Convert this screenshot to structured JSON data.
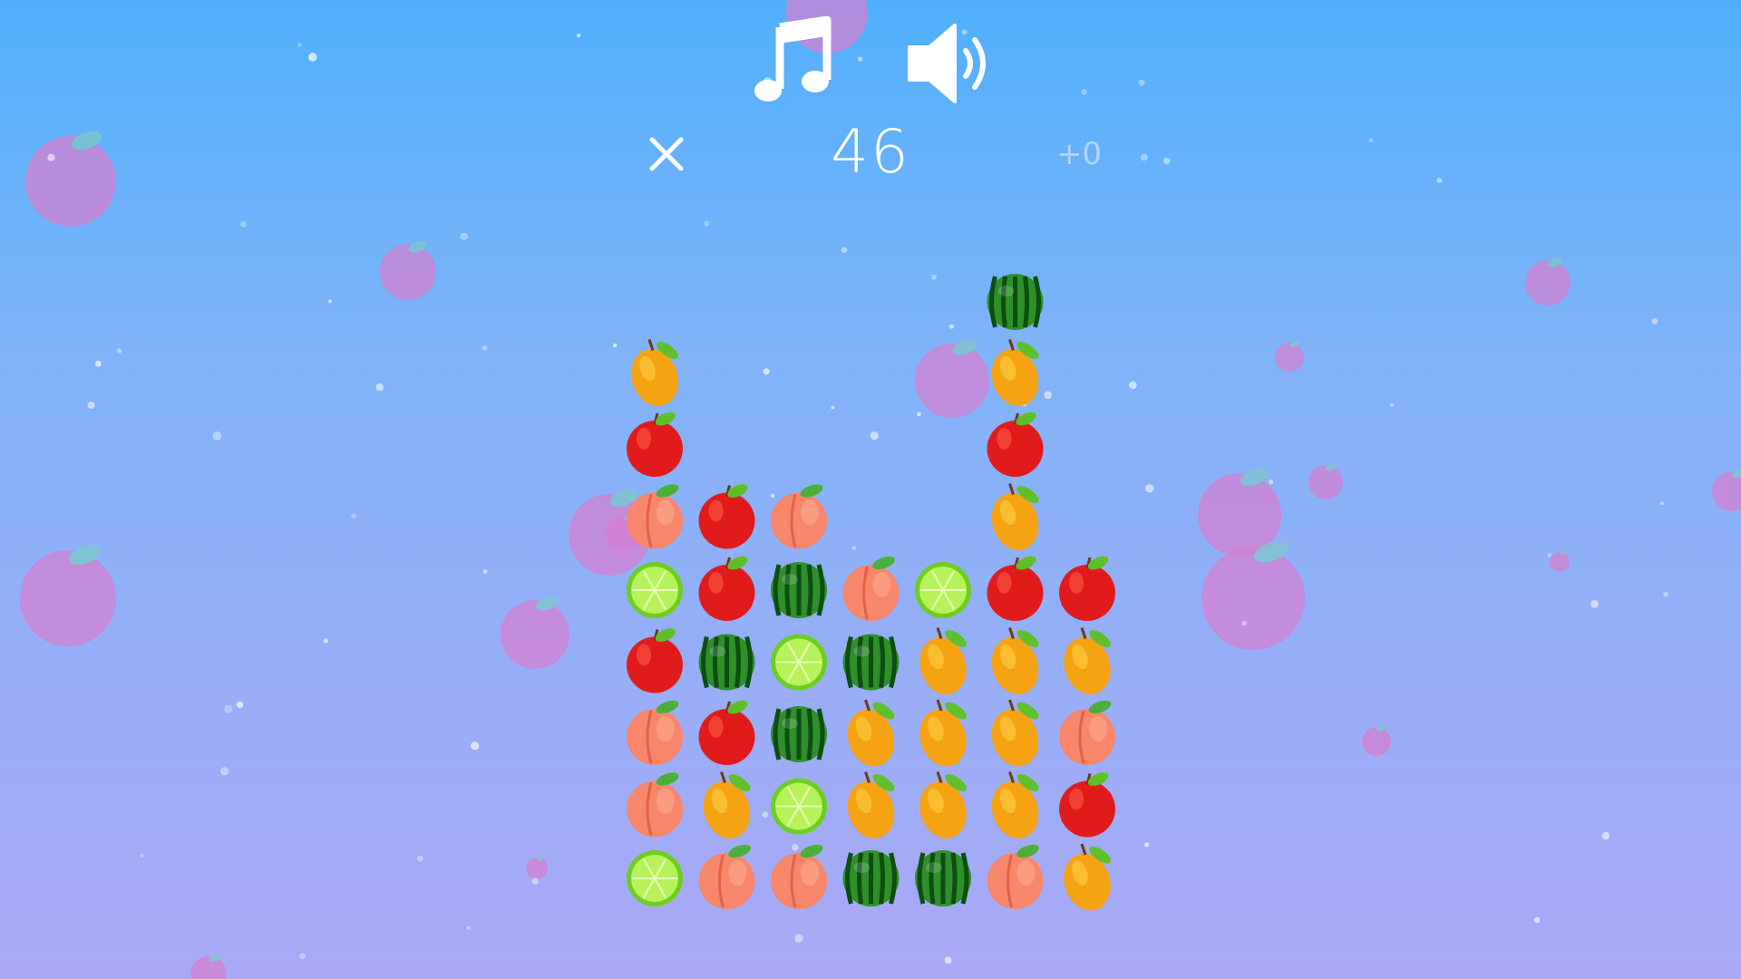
{
  "hud": {
    "music_icon": "music-note-icon",
    "sound_icon": "speaker-icon",
    "close_icon": "close-icon",
    "score": "46",
    "bonus": "+0"
  },
  "colors": {
    "sky_top": "#4faffc",
    "sky_bottom": "#aba9f6",
    "bubble": "#d67fd0",
    "hud_text": "#ffffff",
    "bonus_text": "#b2d4fb"
  },
  "board": {
    "columns": 7,
    "rows": 9,
    "grid": [
      [
        "",
        "",
        "",
        "",
        "",
        "watermelon",
        ""
      ],
      [
        "mango",
        "",
        "",
        "",
        "",
        "mango",
        ""
      ],
      [
        "apple",
        "",
        "",
        "",
        "",
        "apple",
        ""
      ],
      [
        "peach",
        "apple",
        "peach",
        "",
        "",
        "mango",
        ""
      ],
      [
        "lime",
        "apple",
        "watermelon",
        "peach",
        "lime",
        "apple",
        "apple"
      ],
      [
        "apple",
        "watermelon",
        "lime",
        "watermelon",
        "mango",
        "mango",
        "mango"
      ],
      [
        "peach",
        "apple",
        "watermelon",
        "mango",
        "mango",
        "mango",
        "peach"
      ],
      [
        "peach",
        "mango",
        "lime",
        "mango",
        "mango",
        "mango",
        "apple"
      ],
      [
        "lime",
        "peach",
        "peach",
        "watermelon",
        "watermelon",
        "peach",
        "mango"
      ]
    ]
  }
}
